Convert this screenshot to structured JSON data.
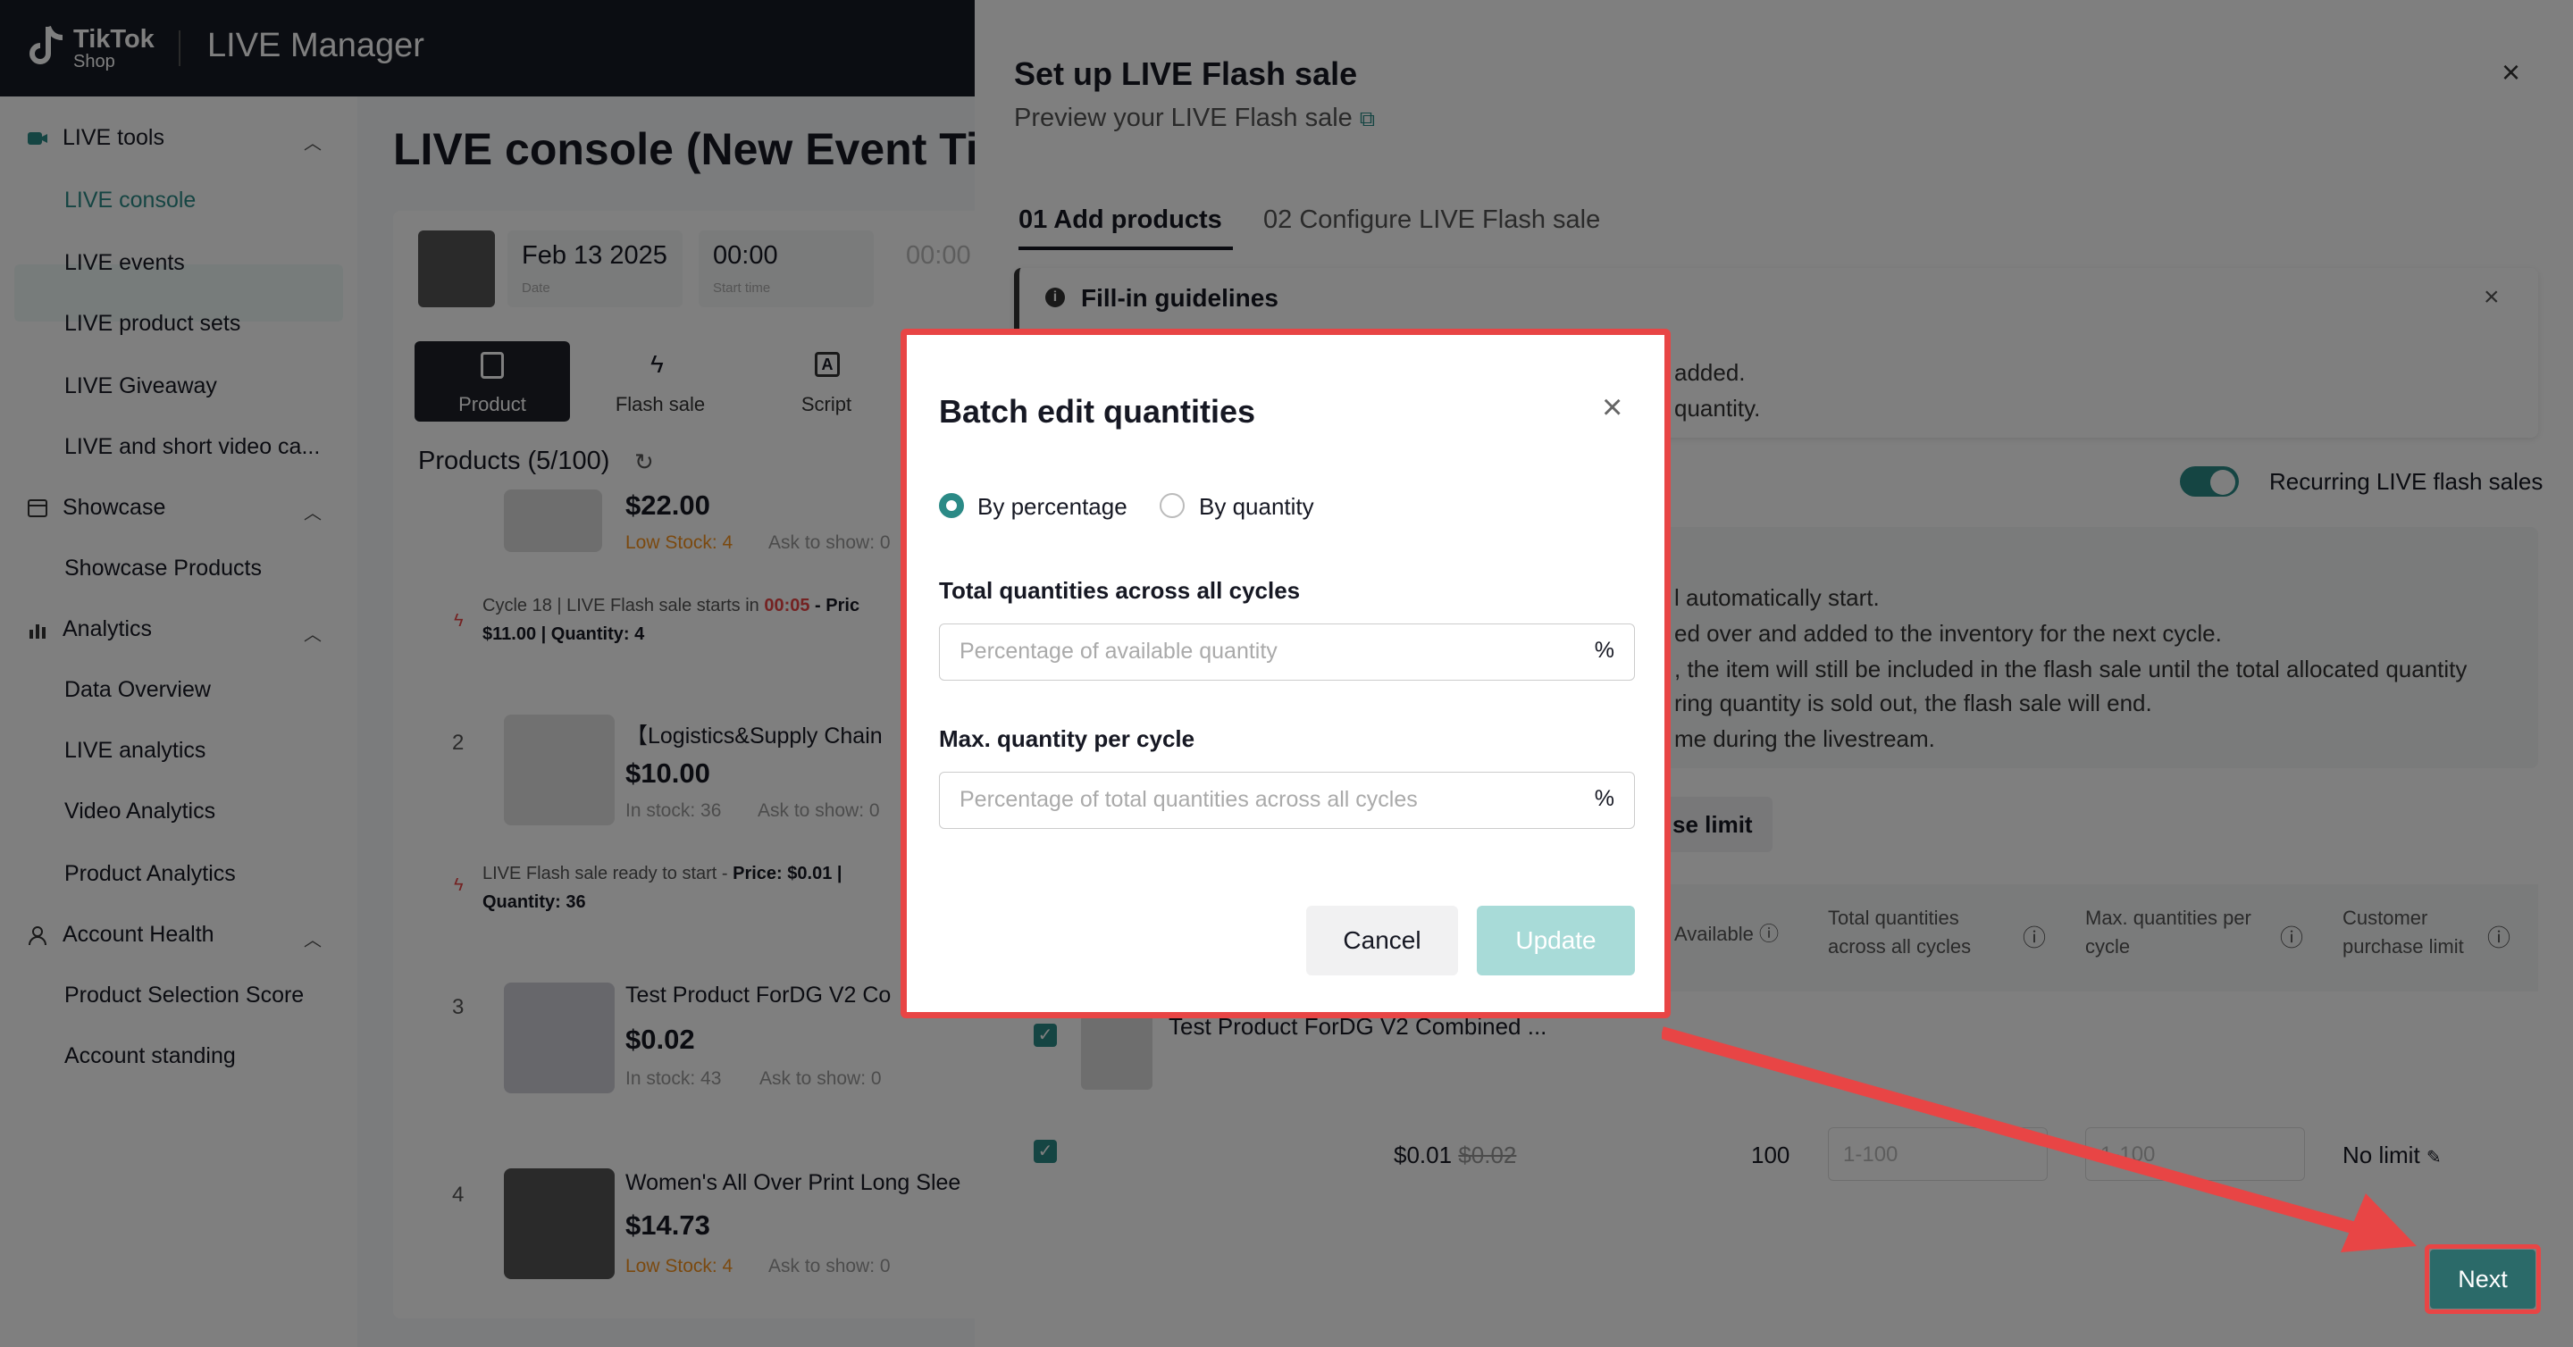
{
  "app": {
    "brand": "TikTok",
    "brand_sub": "Shop",
    "title": "LIVE Manager"
  },
  "sidebar": {
    "groups": [
      {
        "label": "LIVE tools",
        "items": [
          "LIVE console",
          "LIVE events",
          "LIVE product sets",
          "LIVE Giveaway",
          "LIVE and short video ca..."
        ]
      },
      {
        "label": "Showcase",
        "items": [
          "Showcase Products"
        ]
      },
      {
        "label": "Analytics",
        "items": [
          "Data Overview",
          "LIVE analytics",
          "Video Analytics",
          "Product Analytics"
        ]
      },
      {
        "label": "Account Health",
        "items": [
          "Product Selection Score",
          "Account standing"
        ]
      }
    ],
    "active_item": "LIVE console"
  },
  "console": {
    "title": "LIVE console (New Event Ti",
    "date": "Feb 13 2025",
    "date_label": "Date",
    "start_time": "00:00",
    "start_label": "Start time",
    "end_time": "00:00",
    "tabs": [
      "Product",
      "Flash sale",
      "Script"
    ],
    "products_header": "Products (5/100)",
    "products": [
      {
        "num": "",
        "name": "",
        "price": "$22.00",
        "stock": "Low Stock: 4",
        "ask": "Ask to show: 0",
        "flash": "Cycle 18  |  LIVE Flash sale starts in ",
        "flash_time": "00:05",
        "flash_price": " - Pric",
        "flash_detail": "$11.00 | Quantity: 4"
      },
      {
        "num": "2",
        "name": "【Logistics&Supply Chain",
        "price": "$10.00",
        "stock": "In stock: 36",
        "ask": "Ask to show: 0",
        "flash": "LIVE Flash sale ready to start - ",
        "flash_price": "Price: $0.01 |",
        "flash_detail": "Quantity: 36"
      },
      {
        "num": "3",
        "name": "Test Product ForDG V2 Co",
        "price": "$0.02",
        "stock": "In stock: 43",
        "ask": "Ask to show: 0"
      },
      {
        "num": "4",
        "name": "Women's All Over Print Long Slee",
        "price": "$14.73",
        "stock": "Low Stock: 4",
        "ask": "Ask to show: 0"
      }
    ]
  },
  "drawer": {
    "title": "Set up LIVE Flash sale",
    "subtitle": "Preview your LIVE Flash sale",
    "steps": [
      {
        "num": "01",
        "label": "Add products"
      },
      {
        "num": "02",
        "label": "Configure LIVE Flash sale"
      }
    ],
    "guidelines_title": "Fill-in guidelines",
    "guideline_lines": [
      "added.",
      "quantity."
    ],
    "recurring_label": "Recurring LIVE flash sales",
    "recurring_on": true,
    "panel_lines": [
      "l automatically start.",
      "ed over and added to the inventory for the next cycle.",
      ", the item will still be included in the flash sale until the total allocated quantity",
      "ring quantity is sold out, the flash sale will end.",
      "me during the livestream."
    ],
    "purchase_limit_btn": "se limit",
    "table_headers": [
      "Available",
      "Total quantities across all cycles",
      "Max. quantities per cycle",
      "Customer purchase limit"
    ],
    "row_product": "Test Product ForDG V2 Combined ...",
    "row_price": "$0.01",
    "row_orig_price": "$0.02",
    "row_available": "100",
    "row_total_placeholder": "1-100",
    "row_max_placeholder": "1-100",
    "row_limit": "No limit",
    "next_label": "Next"
  },
  "modal": {
    "title": "Batch edit quantities",
    "radio_percentage": "By percentage",
    "radio_quantity": "By quantity",
    "selected": "percentage",
    "field1_label": "Total quantities across all cycles",
    "field1_placeholder": "Percentage of available quantity",
    "field2_label": "Max. quantity per cycle",
    "field2_placeholder": "Percentage of total quantities across all cycles",
    "unit": "%",
    "cancel": "Cancel",
    "update": "Update"
  },
  "colors": {
    "accent": "#2b8a86",
    "highlight": "#e84545",
    "topbar": "#171a24"
  }
}
